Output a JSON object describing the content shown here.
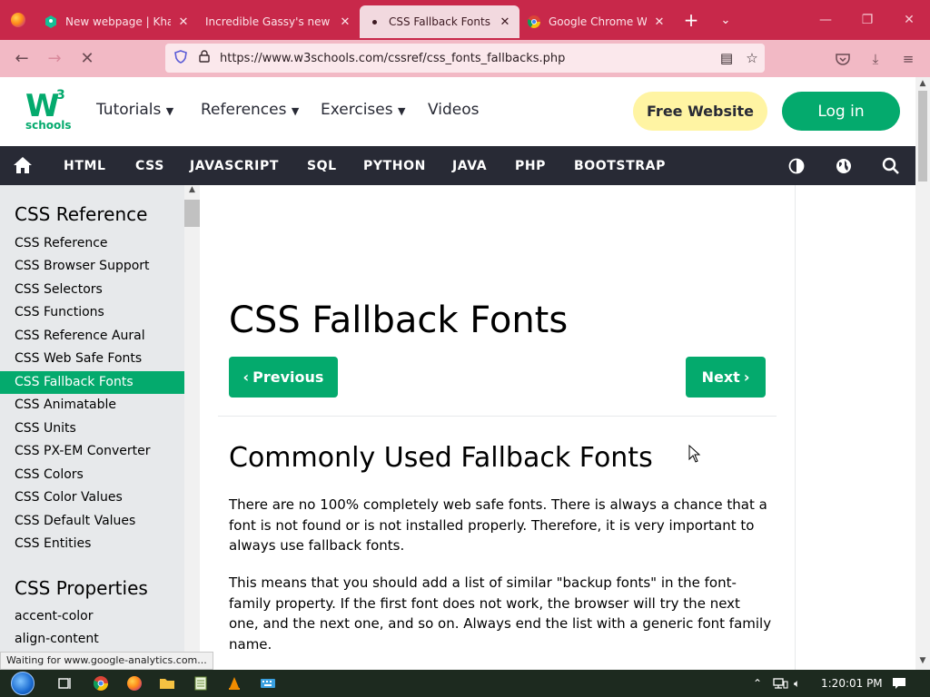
{
  "browser": {
    "tabs": [
      {
        "title": "New webpage | Khan A",
        "icon": "khan-academy-icon",
        "active": false
      },
      {
        "title": "Incredible Gassy's new hom",
        "icon": "",
        "active": false
      },
      {
        "title": "CSS Fallback Fonts",
        "icon": "loading-dot-icon",
        "active": true
      },
      {
        "title": "Google Chrome Web B",
        "icon": "chrome-icon",
        "active": false
      }
    ],
    "url": "https://www.w3schools.com/cssref/css_fonts_fallbacks.php",
    "status_text": "Waiting for www.google-analytics.com..."
  },
  "site": {
    "logo": {
      "main": "W",
      "sup": "3",
      "sub": "schools"
    },
    "menu": {
      "tutorials": "Tutorials",
      "references": "References",
      "exercises": "Exercises",
      "videos": "Videos"
    },
    "free_website": "Free Website",
    "login": "Log in",
    "subjects": [
      "HTML",
      "CSS",
      "JAVASCRIPT",
      "SQL",
      "PYTHON",
      "JAVA",
      "PHP",
      "BOOTSTRAP"
    ]
  },
  "sidebar": {
    "heading1": "CSS Reference",
    "items": [
      "CSS Reference",
      "CSS Browser Support",
      "CSS Selectors",
      "CSS Functions",
      "CSS Reference Aural",
      "CSS Web Safe Fonts",
      "CSS Fallback Fonts",
      "CSS Animatable",
      "CSS Units",
      "CSS PX-EM Converter",
      "CSS Colors",
      "CSS Color Values",
      "CSS Default Values",
      "CSS Entities"
    ],
    "active_index": 6,
    "heading2": "CSS Properties",
    "properties": [
      "accent-color",
      "align-content"
    ]
  },
  "main": {
    "title": "CSS Fallback Fonts",
    "prev": "Previous",
    "next": "Next",
    "h2": "Commonly Used Fallback Fonts",
    "para1": "There are no 100% completely web safe fonts. There is always a chance that a font is not found or is not installed properly. Therefore, it is very important to always use fallback fonts.",
    "para2": "This means that you should add a list of similar \"backup fonts\" in the font-family property. If the first font does not work, the browser will try the next one, and the next one, and so on. Always end the list with a generic font family name."
  },
  "taskbar": {
    "time": "1:20:01 PM"
  },
  "colors": {
    "accent": "#04aa6d",
    "browser_chrome": "#c8284a",
    "dark_bar": "#282a35",
    "sidebar_bg": "#e7e9eb",
    "free_btn": "#fff4a3"
  }
}
